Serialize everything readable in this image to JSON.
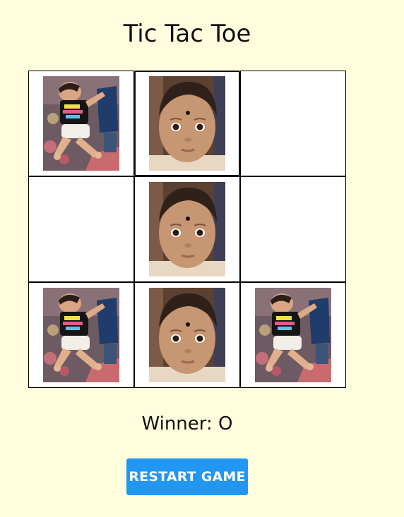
{
  "title": "Tic Tac Toe",
  "status_text": "Winner: O",
  "restart_label": "RESTART GAME",
  "colors": {
    "background": "#fffddd",
    "button": "#2196f3",
    "cell": "#ffffff"
  },
  "board": {
    "cells": [
      "X",
      "O",
      "",
      "",
      "O",
      "",
      "X",
      "O",
      "X"
    ],
    "focused_cell": 1
  },
  "markers": {
    "X": "photo-baby-lying-down",
    "O": "photo-baby-face"
  }
}
